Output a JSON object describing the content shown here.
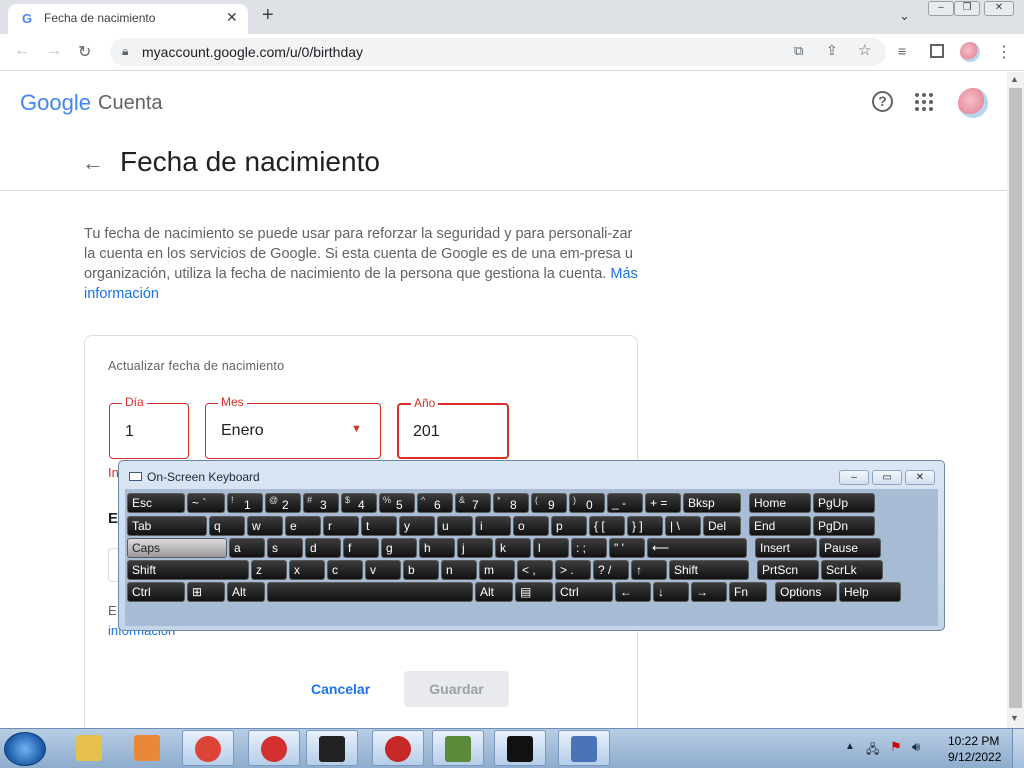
{
  "browser": {
    "tab_title": "Fecha de nacimiento",
    "tab_favicon": "G",
    "url": "myaccount.google.com/u/0/birthday",
    "icons": [
      "back-arrow-icon",
      "forward-arrow-icon",
      "reload-icon",
      "lock-icon",
      "translate-icon",
      "share-icon",
      "star-icon",
      "media-icon",
      "sidebar-icon",
      "profile-avatar",
      "menu-dots-icon"
    ]
  },
  "header": {
    "logo_text": "Google",
    "product": "Cuenta",
    "help_icon": "?"
  },
  "page": {
    "title": "Fecha de nacimiento",
    "description": "Tu fecha de nacimiento se puede usar para reforzar la seguridad y para personali-zar la cuenta en los servicios de Google. Si esta cuenta de Google es de una em-presa u organización, utiliza la fecha de nacimiento de la persona que gestiona la cuenta.",
    "more_info": "Más información",
    "card_title": "Actualizar fecha de nacimiento",
    "day_label": "Día",
    "day_value": "1",
    "month_label": "Mes",
    "month_value": "Enero",
    "year_label": "Año",
    "year_value": "201",
    "partial_error": "In",
    "partial_heading": "E",
    "partial_text": "E",
    "partial_link": "información",
    "cancel": "Cancelar",
    "save": "Guardar"
  },
  "osk": {
    "title": "On-Screen Keyboard",
    "rows": [
      [
        {
          "l": "Esc",
          "w": 60
        },
        {
          "l": "~ `",
          "w": 40
        },
        {
          "l": "1",
          "s": "!",
          "w": 38
        },
        {
          "l": "2",
          "s": "@",
          "w": 38
        },
        {
          "l": "3",
          "s": "#",
          "w": 38
        },
        {
          "l": "4",
          "s": "$",
          "w": 38
        },
        {
          "l": "5",
          "s": "%",
          "w": 38
        },
        {
          "l": "6",
          "s": "^",
          "w": 38
        },
        {
          "l": "7",
          "s": "&",
          "w": 38
        },
        {
          "l": "8",
          "s": "*",
          "w": 38
        },
        {
          "l": "9",
          "s": "(",
          "w": 38
        },
        {
          "l": "0",
          "s": ")",
          "w": 38
        },
        {
          "l": "_ -",
          "w": 38
        },
        {
          "l": "+ =",
          "w": 38
        },
        {
          "l": "Bksp",
          "w": 60
        },
        {
          "l": "Home",
          "w": 64,
          "gap": 6
        },
        {
          "l": "PgUp",
          "w": 64
        }
      ],
      [
        {
          "l": "Tab",
          "w": 82
        },
        {
          "l": "q",
          "w": 38
        },
        {
          "l": "w",
          "w": 38
        },
        {
          "l": "e",
          "w": 38
        },
        {
          "l": "r",
          "w": 38
        },
        {
          "l": "t",
          "w": 38
        },
        {
          "l": "y",
          "w": 38
        },
        {
          "l": "u",
          "w": 38
        },
        {
          "l": "i",
          "w": 38
        },
        {
          "l": "o",
          "w": 38
        },
        {
          "l": "p",
          "w": 38
        },
        {
          "l": "{ [",
          "w": 38
        },
        {
          "l": "} ]",
          "w": 38
        },
        {
          "l": "| \\",
          "w": 38
        },
        {
          "l": "Del",
          "w": 40
        },
        {
          "l": "End",
          "w": 64,
          "gap": 6
        },
        {
          "l": "PgDn",
          "w": 64
        }
      ],
      [
        {
          "l": "Caps",
          "w": 102,
          "active": true
        },
        {
          "l": "a",
          "w": 38
        },
        {
          "l": "s",
          "w": 38
        },
        {
          "l": "d",
          "w": 38
        },
        {
          "l": "f",
          "w": 38
        },
        {
          "l": "g",
          "w": 38
        },
        {
          "l": "h",
          "w": 38
        },
        {
          "l": "j",
          "w": 38
        },
        {
          "l": "k",
          "w": 38
        },
        {
          "l": "l",
          "w": 38
        },
        {
          "l": ": ;",
          "w": 38
        },
        {
          "l": "\" '",
          "w": 38
        },
        {
          "l": "⟵",
          "w": 102
        },
        {
          "l": "Insert",
          "w": 64,
          "gap": 6
        },
        {
          "l": "Pause",
          "w": 64
        }
      ],
      [
        {
          "l": "Shift",
          "w": 124
        },
        {
          "l": "z",
          "w": 38
        },
        {
          "l": "x",
          "w": 38
        },
        {
          "l": "c",
          "w": 38
        },
        {
          "l": "v",
          "w": 38
        },
        {
          "l": "b",
          "w": 38
        },
        {
          "l": "n",
          "w": 38
        },
        {
          "l": "m",
          "w": 38
        },
        {
          "l": "< ,",
          "w": 38
        },
        {
          "l": "> .",
          "w": 38
        },
        {
          "l": "? /",
          "w": 38
        },
        {
          "l": "↑",
          "w": 38
        },
        {
          "l": "Shift",
          "w": 82
        },
        {
          "l": "PrtScn",
          "w": 64,
          "gap": 6
        },
        {
          "l": "ScrLk",
          "w": 64
        }
      ],
      [
        {
          "l": "Ctrl",
          "w": 60
        },
        {
          "l": "⊞",
          "w": 40
        },
        {
          "l": "Alt",
          "w": 40
        },
        {
          "l": "",
          "w": 208
        },
        {
          "l": "Alt",
          "w": 40
        },
        {
          "l": "▤",
          "w": 40
        },
        {
          "l": "Ctrl",
          "w": 60
        },
        {
          "l": "←",
          "w": 38
        },
        {
          "l": "↓",
          "w": 38
        },
        {
          "l": "→",
          "w": 38
        },
        {
          "l": "Fn",
          "w": 40
        },
        {
          "l": "Options",
          "w": 64,
          "gap": 6
        },
        {
          "l": "Help",
          "w": 64
        }
      ]
    ]
  },
  "taskbar": {
    "apps": [
      "explorer-icon",
      "media-player-icon",
      "chrome-icon",
      "power-app-icon",
      "7zip-icon",
      "record-icon",
      "minecraft-icon",
      "cmd-icon",
      "osk-icon"
    ],
    "time": "10:22 PM",
    "date": "9/12/2022"
  }
}
